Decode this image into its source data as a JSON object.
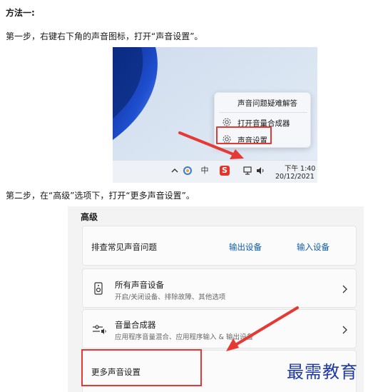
{
  "document": {
    "heading": "方法一:",
    "step1": "第一步，右键右下角的声音图标，打开“声音设置”。",
    "step2": "第二步，在“高级”选项下，打开“更多声音设置”。",
    "watermark": "最需教育"
  },
  "screenshot1": {
    "context_menu": {
      "items": [
        {
          "label": "声音问题疑难解答",
          "icon": "none"
        },
        {
          "label": "打开音量合成器",
          "icon": "gear-icon"
        },
        {
          "label": "声音设置",
          "icon": "gear-icon",
          "highlighted": true
        }
      ]
    },
    "taskbar": {
      "tray_icons": [
        "chevron-up-icon",
        "copilot-icon",
        "ime-icon",
        "sogou-icon",
        "network-icon",
        "volume-icon"
      ],
      "ime_label": "中",
      "sogou_label": "S",
      "time": "下午 1:40",
      "date": "20/12/2021"
    }
  },
  "screenshot2": {
    "section_title": "高级",
    "troubleshoot_card": {
      "title": "排查常见声音问题",
      "link_output": "输出设备",
      "link_input": "输入设备"
    },
    "all_devices_card": {
      "title": "所有声音设备",
      "subtitle": "开启/关闭设备、排除故障、其他选项",
      "icon": "speaker-icon"
    },
    "volume_mixer_card": {
      "title": "音量合成器",
      "subtitle": "应用程序音量混合、应用程序输入 & 输出设备",
      "icon": "mixer-icon"
    },
    "more_settings_card": {
      "title": "更多声音设置",
      "highlighted": true
    }
  },
  "colors": {
    "highlight": "#e53935",
    "arrow": "#e53935",
    "link": "#0b5cad",
    "watermark": "#1f3aa8"
  }
}
